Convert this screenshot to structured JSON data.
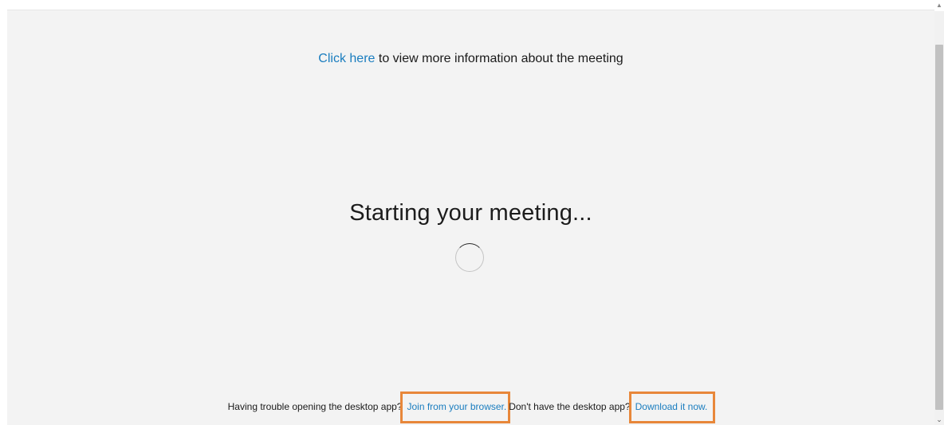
{
  "info": {
    "link_text": "Click here",
    "rest_text": " to view more information about the meeting"
  },
  "status": {
    "heading": "Starting your meeting..."
  },
  "footer": {
    "trouble_text": "Having trouble opening the desktop app?",
    "browser_link": "Join from your browser.",
    "no_app_text": "Don't have the desktop app?",
    "download_link": "Download it now."
  },
  "icons": {
    "spinner": "loading-spinner-icon",
    "scroll_up": "chevron-up-icon",
    "scroll_down": "chevron-down-icon"
  },
  "colors": {
    "link": "#1a7dbf",
    "highlight": "#e8873a",
    "background": "#f3f3f3"
  }
}
